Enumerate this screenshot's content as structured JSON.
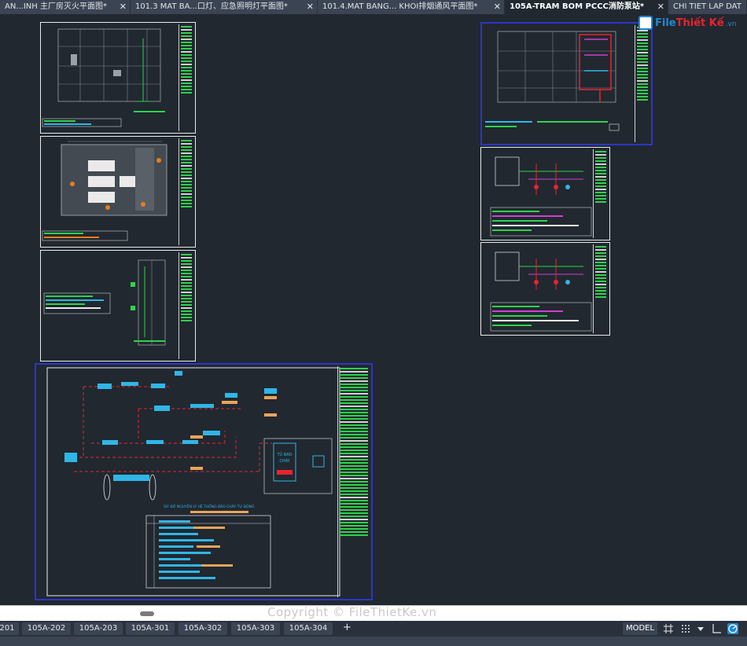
{
  "tabs": [
    {
      "label": "AN...INH 主厂房灭火平面图*",
      "active": false
    },
    {
      "label": "101.3 MAT BA...口灯、应急照明灯平面图*",
      "active": false
    },
    {
      "label": "101.4.MAT BANG... KHOI排烟通风平面图*",
      "active": false
    },
    {
      "label": "105A-TRAM BOM PCCC消防泵站*",
      "active": true
    },
    {
      "label": "CHI TIET LAP DAT",
      "active": false
    }
  ],
  "tab_close_glyph": "✕",
  "logo": {
    "part1": "File",
    "part2": "Thiết Kế",
    "part3": ".vn"
  },
  "watermark": "Copyright © FileThietKe.vn",
  "drawing": {
    "bottom_heading": "SƠ ĐỒ NGUYÊN LÝ HỆ THỐNG BÁO CHÁY TỰ ĐỘNG",
    "panel_lines": [
      "TỦ BÁO",
      "CHÁY"
    ]
  },
  "layout_tabs": [
    "201",
    "105A-202",
    "105A-203",
    "105A-301",
    "105A-302",
    "105A-303",
    "105A-304"
  ],
  "add_layout": "+",
  "status": {
    "model": "MODEL"
  },
  "status_icons": [
    "grid-icon",
    "snap-icon",
    "dropdown-icon",
    "ortho-icon",
    "polar-icon"
  ],
  "colors": {
    "canvas": "#212830",
    "accent_green": "#2fd14a",
    "accent_red": "#e8242e",
    "accent_cyan": "#2fb6e6",
    "selection": "#2c36c8"
  }
}
